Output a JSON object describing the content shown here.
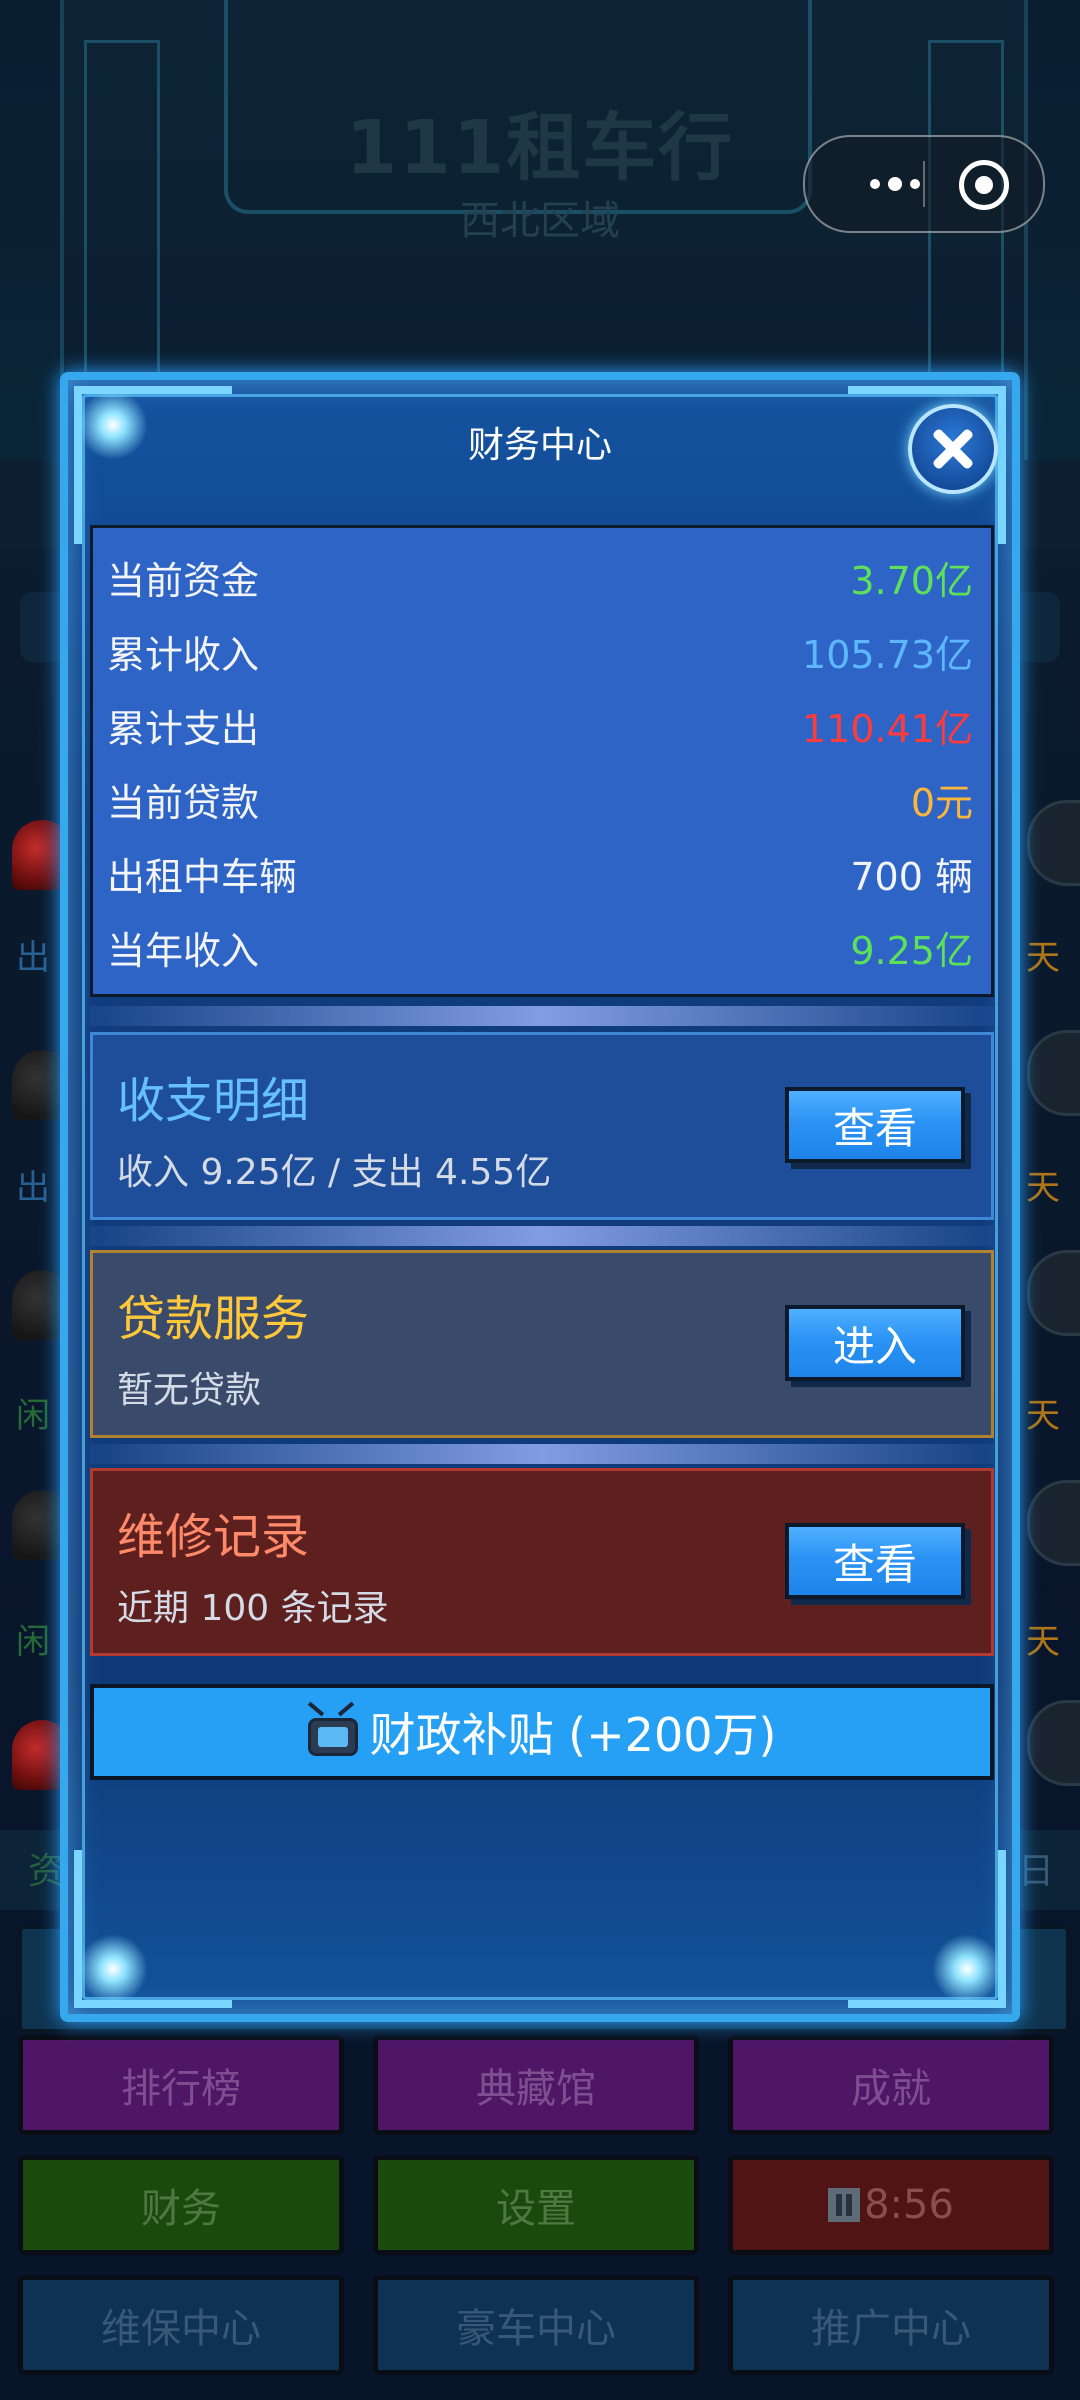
{
  "background": {
    "title": "111租车行",
    "subtitle": "西北区域",
    "side_tags": {
      "left": [
        "出",
        "出",
        "闲",
        "闲"
      ],
      "right": [
        "天",
        "天",
        "天",
        "天"
      ]
    },
    "strip": {
      "left": "资",
      "right": "日"
    },
    "buttons": {
      "row1": [
        "排行榜",
        "典藏馆",
        "成就"
      ],
      "row2": [
        "财务",
        "设置",
        "8:56"
      ],
      "row3": [
        "维保中心",
        "豪车中心",
        "推广中心"
      ]
    }
  },
  "modal": {
    "title": "财务中心",
    "stats": [
      {
        "label": "当前资金",
        "value": "3.70亿",
        "color": "#5fe05a"
      },
      {
        "label": "累计收入",
        "value": "105.73亿",
        "color": "#5db7ff"
      },
      {
        "label": "累计支出",
        "value": "110.41亿",
        "color": "#ff3b3b"
      },
      {
        "label": "当前贷款",
        "value": "0元",
        "color": "#ffb43a"
      },
      {
        "label": "出租中车辆",
        "value": "700 辆",
        "color": "#f2f4f8"
      },
      {
        "label": "当年收入",
        "value": "9.25亿",
        "color": "#5fe05a"
      }
    ],
    "cards": [
      {
        "title": "收支明细",
        "desc": "收入 9.25亿 / 支出 4.55亿",
        "button": "查看"
      },
      {
        "title": "贷款服务",
        "desc": "暂无贷款",
        "button": "进入"
      },
      {
        "title": "维修记录",
        "desc": "近期 100 条记录",
        "button": "查看"
      }
    ],
    "subsidy_label": "财政补贴 (+200万)"
  }
}
